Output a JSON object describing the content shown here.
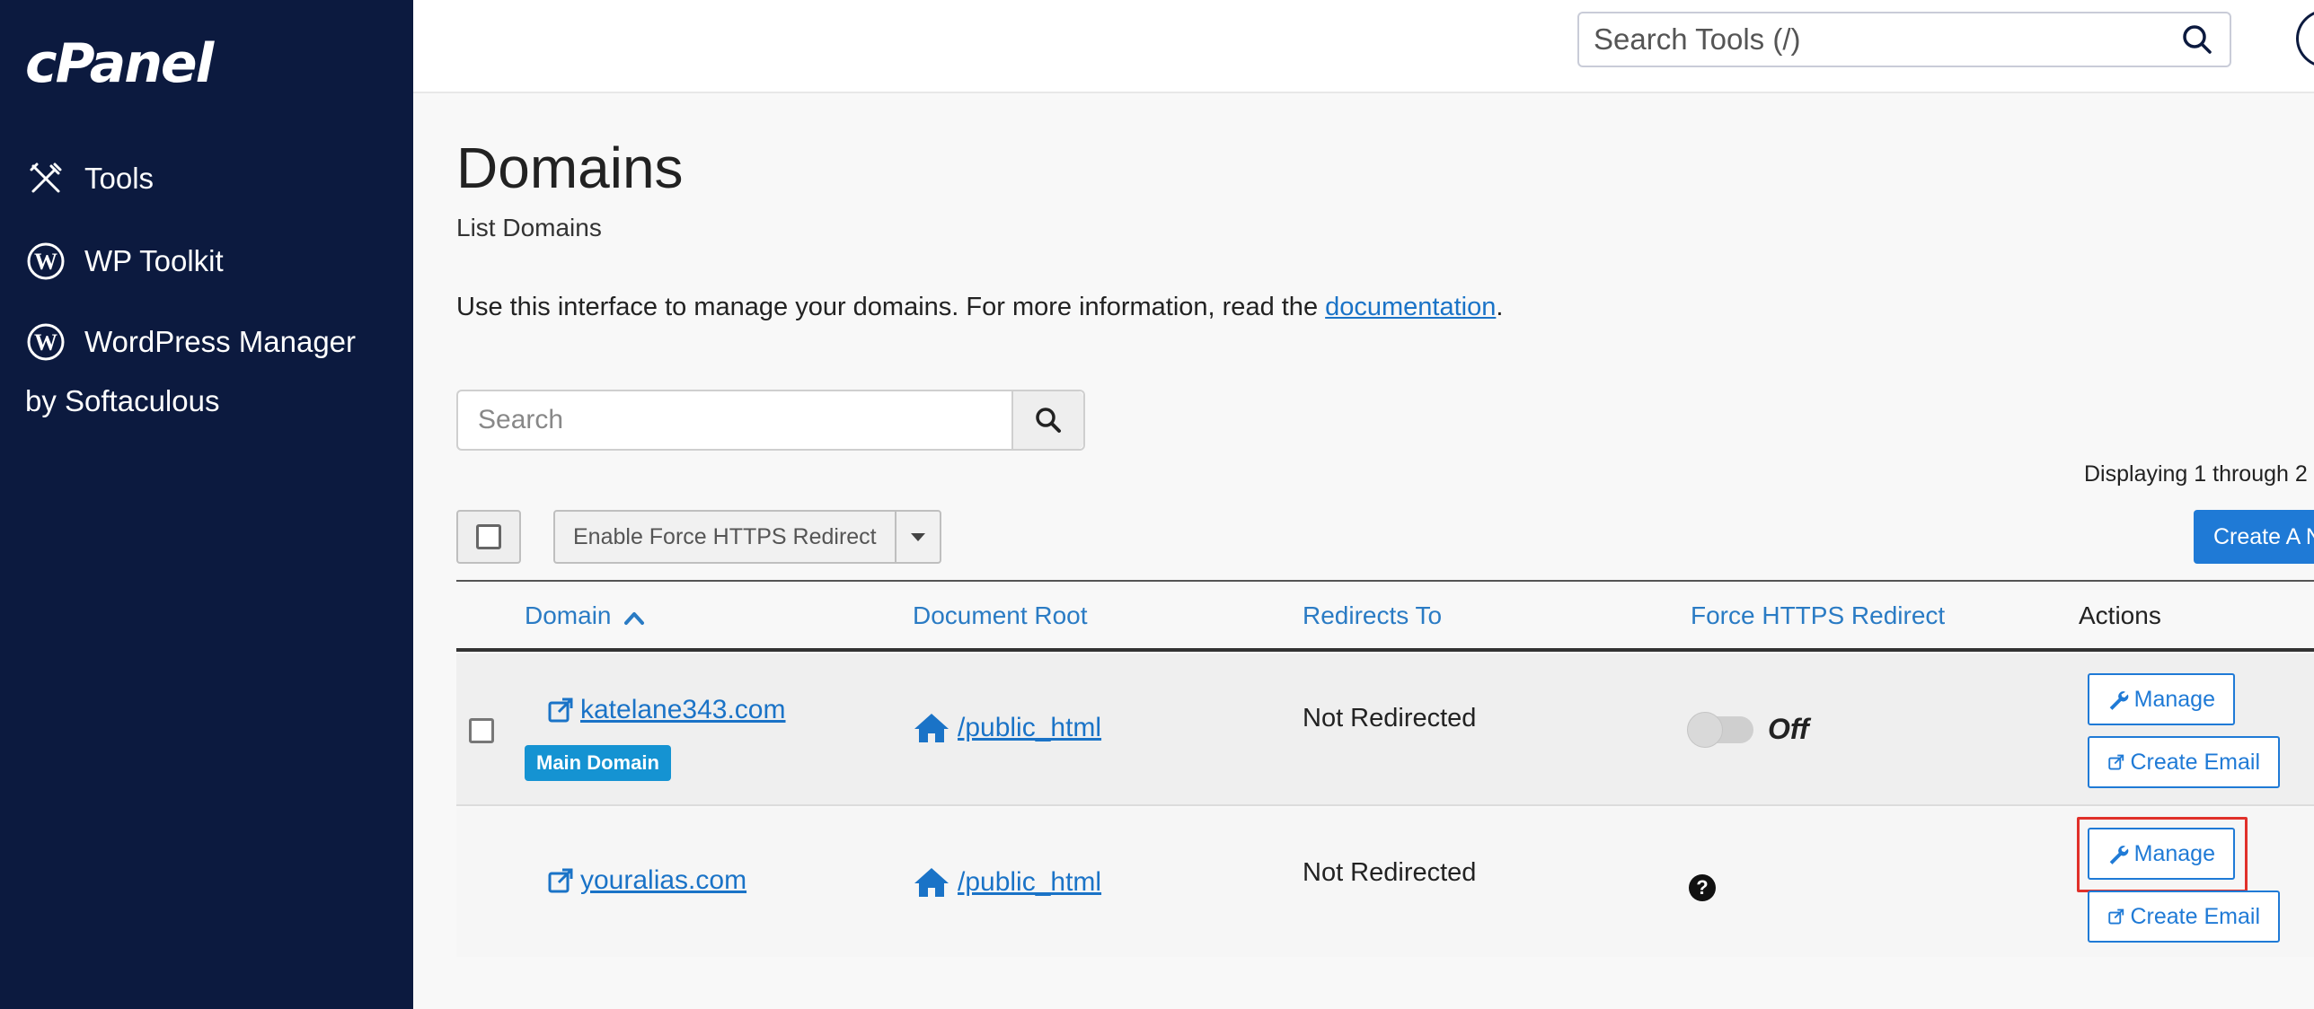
{
  "sidebar": {
    "logo": "cPanel",
    "items": [
      {
        "label": "Tools",
        "icon": "tools-icon"
      },
      {
        "label": "WP Toolkit",
        "icon": "wordpress-icon"
      },
      {
        "label": "WordPress Manager",
        "label_line2": "by Softaculous",
        "icon": "wordpress-icon"
      }
    ]
  },
  "header": {
    "search_placeholder": "Search Tools (/)"
  },
  "page": {
    "title": "Domains",
    "subtitle": "List Domains",
    "intro_text": "Use this interface to manage your domains. For more information, read the ",
    "intro_link": "documentation",
    "intro_end": "."
  },
  "list": {
    "search_placeholder": "Search",
    "displaying": "Displaying 1 through 2",
    "bulk_action": "Enable Force HTTPS Redirect",
    "create_button": "Create A N"
  },
  "table": {
    "headers": {
      "domain": "Domain",
      "document_root": "Document Root",
      "redirects_to": "Redirects To",
      "force_https": "Force HTTPS Redirect",
      "actions": "Actions"
    },
    "sort_indicator": "chevron-up-icon",
    "rows": [
      {
        "domain": "katelane343.com",
        "badge": "Main Domain",
        "document_root": "/public_html",
        "redirects_to": "Not Redirected",
        "force_https_state": "Off",
        "manage_label": "Manage",
        "email_label": "Create Email"
      },
      {
        "domain": "youralias.com",
        "document_root": "/public_html",
        "redirects_to": "Not Redirected",
        "force_https_help": "?",
        "manage_label": "Manage",
        "email_label": "Create Email"
      }
    ]
  },
  "colors": {
    "sidebar_bg": "#0c1a3f",
    "link": "#1a73c7",
    "primary": "#1f7ad6",
    "badge": "#1593d2",
    "highlight": "#e0302a"
  }
}
